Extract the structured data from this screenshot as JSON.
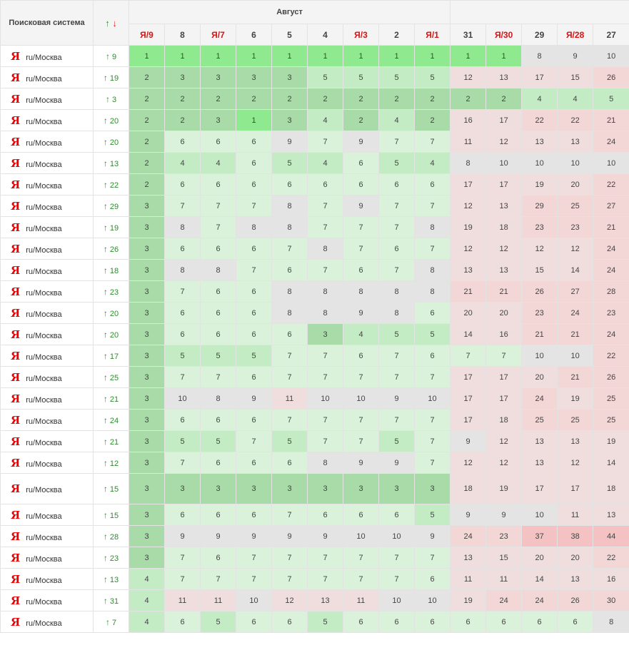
{
  "header": {
    "engine_label": "Поисковая система",
    "sort_up": "↑",
    "sort_down": "↓",
    "month": "Август",
    "columns": [
      {
        "label": "Я/9",
        "yandex": true
      },
      {
        "label": "8",
        "yandex": false
      },
      {
        "label": "Я/7",
        "yandex": true
      },
      {
        "label": "6",
        "yandex": false
      },
      {
        "label": "5",
        "yandex": false
      },
      {
        "label": "4",
        "yandex": false
      },
      {
        "label": "Я/3",
        "yandex": true
      },
      {
        "label": "2",
        "yandex": false
      },
      {
        "label": "Я/1",
        "yandex": true
      },
      {
        "label": "31",
        "yandex": false
      },
      {
        "label": "Я/30",
        "yandex": true
      },
      {
        "label": "29",
        "yandex": false
      },
      {
        "label": "Я/28",
        "yandex": true
      },
      {
        "label": "27",
        "yandex": false
      }
    ]
  },
  "engine_icon": "yandex-logo-icon",
  "engine_logo_letter": "Я",
  "engine_region": "ru/Москва",
  "change_icon": "arrow-up-icon",
  "rows": [
    {
      "change": "9",
      "values": [
        1,
        1,
        1,
        1,
        1,
        1,
        1,
        1,
        1,
        1,
        1,
        8,
        9,
        10
      ]
    },
    {
      "change": "19",
      "values": [
        2,
        3,
        3,
        3,
        3,
        5,
        5,
        5,
        5,
        12,
        13,
        17,
        15,
        26
      ]
    },
    {
      "change": "3",
      "values": [
        2,
        2,
        2,
        2,
        2,
        2,
        2,
        2,
        2,
        2,
        2,
        4,
        4,
        5
      ]
    },
    {
      "change": "20",
      "values": [
        2,
        2,
        3,
        1,
        3,
        4,
        2,
        4,
        2,
        16,
        17,
        22,
        22,
        21
      ]
    },
    {
      "change": "20",
      "values": [
        2,
        6,
        6,
        6,
        9,
        7,
        9,
        7,
        7,
        11,
        12,
        13,
        13,
        24
      ]
    },
    {
      "change": "13",
      "values": [
        2,
        4,
        4,
        6,
        5,
        4,
        6,
        5,
        4,
        8,
        10,
        10,
        10,
        10
      ]
    },
    {
      "change": "22",
      "values": [
        2,
        6,
        6,
        6,
        6,
        6,
        6,
        6,
        6,
        17,
        17,
        19,
        20,
        22
      ]
    },
    {
      "change": "29",
      "values": [
        3,
        7,
        7,
        7,
        8,
        7,
        9,
        7,
        7,
        12,
        13,
        29,
        25,
        27
      ]
    },
    {
      "change": "19",
      "values": [
        3,
        8,
        7,
        8,
        8,
        7,
        7,
        7,
        8,
        19,
        18,
        23,
        23,
        21
      ]
    },
    {
      "change": "26",
      "values": [
        3,
        6,
        6,
        6,
        7,
        8,
        7,
        6,
        7,
        12,
        12,
        12,
        12,
        24
      ]
    },
    {
      "change": "18",
      "values": [
        3,
        8,
        8,
        7,
        6,
        7,
        6,
        7,
        8,
        13,
        13,
        15,
        14,
        24
      ]
    },
    {
      "change": "23",
      "values": [
        3,
        7,
        6,
        6,
        8,
        8,
        8,
        8,
        8,
        21,
        21,
        26,
        27,
        28
      ]
    },
    {
      "change": "20",
      "values": [
        3,
        6,
        6,
        6,
        8,
        8,
        9,
        8,
        6,
        20,
        20,
        23,
        24,
        23
      ]
    },
    {
      "change": "20",
      "values": [
        3,
        6,
        6,
        6,
        6,
        3,
        4,
        5,
        5,
        14,
        16,
        21,
        21,
        24
      ]
    },
    {
      "change": "17",
      "values": [
        3,
        5,
        5,
        5,
        7,
        7,
        6,
        7,
        6,
        7,
        7,
        10,
        10,
        22
      ]
    },
    {
      "change": "25",
      "values": [
        3,
        7,
        7,
        6,
        7,
        7,
        7,
        7,
        7,
        17,
        17,
        20,
        21,
        26
      ]
    },
    {
      "change": "21",
      "values": [
        3,
        10,
        8,
        9,
        11,
        10,
        10,
        9,
        10,
        17,
        17,
        24,
        19,
        25
      ]
    },
    {
      "change": "24",
      "values": [
        3,
        6,
        6,
        6,
        7,
        7,
        7,
        7,
        7,
        17,
        18,
        25,
        25,
        25
      ]
    },
    {
      "change": "21",
      "values": [
        3,
        5,
        5,
        7,
        5,
        7,
        7,
        5,
        7,
        9,
        12,
        13,
        13,
        19
      ]
    },
    {
      "change": "12",
      "values": [
        3,
        7,
        6,
        6,
        6,
        8,
        9,
        9,
        7,
        12,
        12,
        13,
        12,
        14
      ]
    },
    {
      "change": "15",
      "values": [
        3,
        3,
        3,
        3,
        3,
        3,
        3,
        3,
        3,
        18,
        19,
        17,
        17,
        18
      ],
      "tall": true
    },
    {
      "change": "15",
      "values": [
        3,
        6,
        6,
        6,
        7,
        6,
        6,
        6,
        5,
        9,
        9,
        10,
        11,
        13
      ]
    },
    {
      "change": "28",
      "values": [
        3,
        9,
        9,
        9,
        9,
        9,
        10,
        10,
        9,
        24,
        23,
        37,
        38,
        44
      ]
    },
    {
      "change": "23",
      "values": [
        3,
        7,
        6,
        7,
        7,
        7,
        7,
        7,
        7,
        13,
        15,
        20,
        20,
        22
      ]
    },
    {
      "change": "13",
      "values": [
        4,
        7,
        7,
        7,
        7,
        7,
        7,
        7,
        6,
        11,
        11,
        14,
        13,
        16
      ]
    },
    {
      "change": "31",
      "values": [
        4,
        11,
        11,
        10,
        12,
        13,
        11,
        10,
        10,
        19,
        24,
        24,
        26,
        30
      ]
    },
    {
      "change": "7",
      "values": [
        4,
        6,
        5,
        6,
        6,
        5,
        6,
        6,
        6,
        6,
        6,
        6,
        6,
        8
      ]
    }
  ],
  "colors": {
    "pos1": "#8fea8f",
    "pos2_3": "#a9dba9",
    "pos4_5": "#c4ecc4",
    "pos6_7": "#d9f2d9",
    "pos8_10": "#e4e4e4",
    "pos11_20": "#f0dede",
    "pos21_30": "#f3d6d6",
    "pos31_plus": "#f4c2c2"
  }
}
